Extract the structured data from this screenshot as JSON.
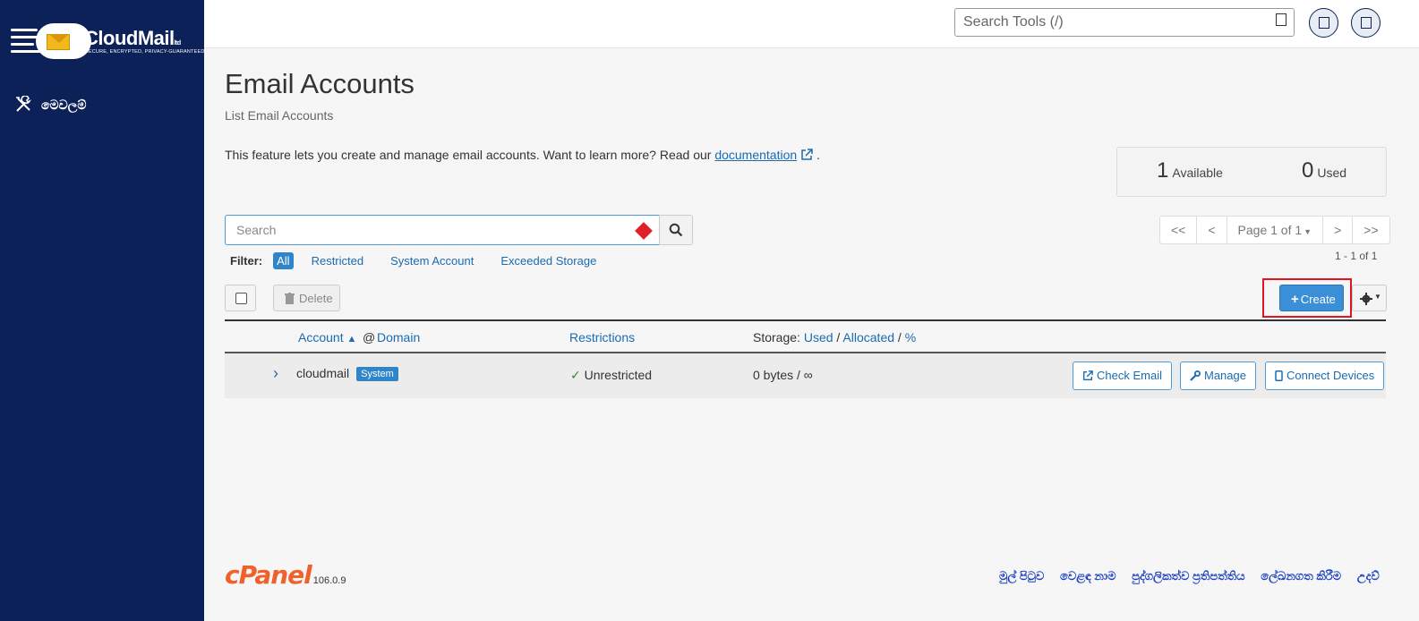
{
  "sidebar": {
    "brand": "CloudMail",
    "brand_suffix": "ltd",
    "tagline": "SECURE, ENCRYPTED, PRIVACY-GUARANTEED",
    "nav_tools_label": "මෙවලම්"
  },
  "topbar": {
    "search_placeholder": "Search Tools (/)"
  },
  "main": {
    "title": "Email Accounts",
    "subtitle": "List Email Accounts",
    "intro_text": "This feature lets you create and manage email accounts. Want to learn more? Read our ",
    "intro_link": "documentation",
    "intro_end": ".",
    "stats": {
      "available_count": "1",
      "available_label": "Available",
      "used_count": "0",
      "used_label": "Used"
    },
    "search_placeholder": "Search",
    "filter": {
      "label": "Filter:",
      "options": [
        "All",
        "Restricted",
        "System Account",
        "Exceeded Storage"
      ]
    },
    "pagination": {
      "first": "<<",
      "prev": "<",
      "page": "Page 1 of 1",
      "next": ">",
      "last": ">>",
      "range": "1 - 1 of 1"
    },
    "delete_label": "Delete",
    "create_label": "Create",
    "table": {
      "col_account": "Account",
      "col_at": "@",
      "col_domain": "Domain",
      "col_restrictions": "Restrictions",
      "col_storage_prefix": "Storage:",
      "col_used": "Used",
      "col_allocated": "Allocated",
      "col_percent": "%",
      "rows": [
        {
          "account": "cloudmail",
          "badge": "System",
          "restriction": "Unrestricted",
          "storage": "0 bytes / ∞",
          "check_email": "Check Email",
          "manage": "Manage",
          "connect": "Connect Devices"
        }
      ]
    }
  },
  "footer": {
    "logo": "cPanel",
    "version": "106.0.9",
    "links": [
      "මුල් පිටුව",
      "වෙළඳ නාම",
      "පුද්ගලිකත්ව ප්‍රතිපත්තිය",
      "ලේඛනගත කිරීම",
      "උදව්"
    ]
  },
  "colors": {
    "sidebar_bg": "#0c2157",
    "accent": "#3a8fd6",
    "highlight": "#e0141e",
    "cpanel_orange": "#f0612b"
  }
}
